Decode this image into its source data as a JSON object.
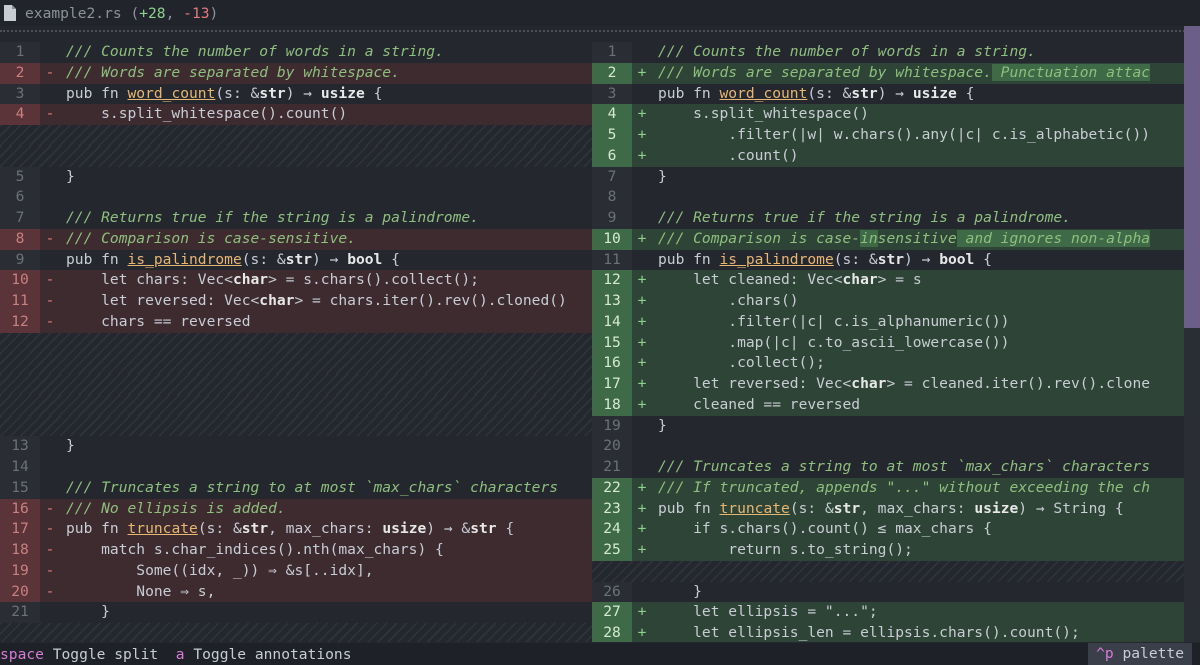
{
  "header": {
    "filename": "example2.rs",
    "open": " (",
    "added": "+28",
    "sep": ", ",
    "removed": "-13",
    "close": ")"
  },
  "footer": {
    "key1": "space",
    "label1": " Toggle split",
    "key2": "a",
    "label2": " Toggle annotations",
    "palette_key": "^p",
    "palette_label": " palette"
  },
  "colors": {
    "added": "#8fd08f",
    "removed": "#e57a7a",
    "accent": "#6b5f8a"
  },
  "left": [
    {
      "t": "norm",
      "n": "1",
      "g": "",
      "c": [
        [
          "com",
          "/// Counts the number of words in a string."
        ]
      ]
    },
    {
      "t": "del",
      "n": "2",
      "g": "-",
      "c": [
        [
          "com",
          "/// Words are separated by whitespace."
        ]
      ]
    },
    {
      "t": "norm",
      "n": "3",
      "g": "",
      "c": [
        [
          "kw",
          "pub fn "
        ],
        [
          "fn",
          "word_count"
        ],
        [
          "kw",
          "(s: &"
        ],
        [
          "ty",
          "str"
        ],
        [
          "kw",
          ") → "
        ],
        [
          "ty",
          "usize"
        ],
        [
          "kw",
          " {"
        ]
      ]
    },
    {
      "t": "del",
      "n": "4",
      "g": "-",
      "c": [
        [
          "kw",
          "    s.split_whitespace().count()"
        ]
      ]
    },
    {
      "t": "filler"
    },
    {
      "t": "filler"
    },
    {
      "t": "norm",
      "n": "5",
      "g": "",
      "c": [
        [
          "kw",
          "}"
        ]
      ]
    },
    {
      "t": "norm",
      "n": "6",
      "g": "",
      "c": []
    },
    {
      "t": "norm",
      "n": "7",
      "g": "",
      "c": [
        [
          "com",
          "/// Returns true if the string is a palindrome."
        ]
      ]
    },
    {
      "t": "del",
      "n": "8",
      "g": "-",
      "c": [
        [
          "com",
          "/// Comparison is case-sensitive."
        ]
      ]
    },
    {
      "t": "norm",
      "n": "9",
      "g": "",
      "c": [
        [
          "kw",
          "pub fn "
        ],
        [
          "fn",
          "is_palindrome"
        ],
        [
          "kw",
          "(s: &"
        ],
        [
          "ty",
          "str"
        ],
        [
          "kw",
          ") → "
        ],
        [
          "ty",
          "bool"
        ],
        [
          "kw",
          " {"
        ]
      ]
    },
    {
      "t": "del",
      "n": "10",
      "g": "-",
      "c": [
        [
          "kw",
          "    let chars: Vec<"
        ],
        [
          "ty",
          "char"
        ],
        [
          "kw",
          "> = s.chars().collect();"
        ]
      ]
    },
    {
      "t": "del",
      "n": "11",
      "g": "-",
      "c": [
        [
          "kw",
          "    let reversed: Vec<"
        ],
        [
          "ty",
          "char"
        ],
        [
          "kw",
          "> = chars.iter().rev().cloned()"
        ]
      ]
    },
    {
      "t": "del",
      "n": "12",
      "g": "-",
      "c": [
        [
          "kw",
          "    chars == reversed"
        ]
      ]
    },
    {
      "t": "filler"
    },
    {
      "t": "filler"
    },
    {
      "t": "filler"
    },
    {
      "t": "filler"
    },
    {
      "t": "filler"
    },
    {
      "t": "norm",
      "n": "13",
      "g": "",
      "c": [
        [
          "kw",
          "}"
        ]
      ]
    },
    {
      "t": "norm",
      "n": "14",
      "g": "",
      "c": []
    },
    {
      "t": "norm",
      "n": "15",
      "g": "",
      "c": [
        [
          "com",
          "/// Truncates a string to at most `max_chars` characters"
        ]
      ]
    },
    {
      "t": "del",
      "n": "16",
      "g": "-",
      "c": [
        [
          "com",
          "/// No ellipsis is added."
        ]
      ]
    },
    {
      "t": "del",
      "n": "17",
      "g": "-",
      "c": [
        [
          "kw",
          "pub fn "
        ],
        [
          "fn",
          "truncate"
        ],
        [
          "kw",
          "(s: &"
        ],
        [
          "ty",
          "str"
        ],
        [
          "kw",
          ", max_chars: "
        ],
        [
          "ty",
          "usize"
        ],
        [
          "kw",
          ") → &"
        ],
        [
          "ty",
          "str"
        ],
        [
          "kw",
          " {"
        ]
      ]
    },
    {
      "t": "del",
      "n": "18",
      "g": "-",
      "c": [
        [
          "kw",
          "    match s.char_indices().nth(max_chars) {"
        ]
      ]
    },
    {
      "t": "del",
      "n": "19",
      "g": "-",
      "c": [
        [
          "kw",
          "        Some((idx, _)) ⇒ &s[..idx],"
        ]
      ]
    },
    {
      "t": "del",
      "n": "20",
      "g": "-",
      "c": [
        [
          "kw",
          "        None ⇒ s,"
        ]
      ]
    },
    {
      "t": "norm",
      "n": "21",
      "g": "",
      "c": [
        [
          "kw",
          "    }"
        ]
      ]
    },
    {
      "t": "filler"
    },
    {
      "t": "filler"
    }
  ],
  "right": [
    {
      "t": "norm",
      "n": "1",
      "g": "",
      "c": [
        [
          "com",
          "/// Counts the number of words in a string."
        ]
      ]
    },
    {
      "t": "add",
      "n": "2",
      "g": "+",
      "c": [
        [
          "com",
          "/// Words are separated by whitespace."
        ],
        [
          "comhl",
          " Punctuation attac"
        ]
      ]
    },
    {
      "t": "norm",
      "n": "3",
      "g": "",
      "c": [
        [
          "kw",
          "pub fn "
        ],
        [
          "fn",
          "word_count"
        ],
        [
          "kw",
          "(s: &"
        ],
        [
          "ty",
          "str"
        ],
        [
          "kw",
          ") → "
        ],
        [
          "ty",
          "usize"
        ],
        [
          "kw",
          " {"
        ]
      ]
    },
    {
      "t": "add",
      "n": "4",
      "g": "+",
      "c": [
        [
          "kw",
          "    s.split_whitespace()"
        ]
      ]
    },
    {
      "t": "add",
      "n": "5",
      "g": "+",
      "c": [
        [
          "kw",
          "        .filter(|w| w.chars().any(|c| c.is_alphabetic())"
        ]
      ]
    },
    {
      "t": "add",
      "n": "6",
      "g": "+",
      "c": [
        [
          "kw",
          "        .count()"
        ]
      ]
    },
    {
      "t": "norm",
      "n": "7",
      "g": "",
      "c": [
        [
          "kw",
          "}"
        ]
      ]
    },
    {
      "t": "norm",
      "n": "8",
      "g": "",
      "c": []
    },
    {
      "t": "norm",
      "n": "9",
      "g": "",
      "c": [
        [
          "com",
          "/// Returns true if the string is a palindrome."
        ]
      ]
    },
    {
      "t": "add",
      "n": "10",
      "g": "+",
      "c": [
        [
          "com",
          "/// Comparison is case-"
        ],
        [
          "comhl",
          "in"
        ],
        [
          "com",
          "sensitive"
        ],
        [
          "comhl",
          " and ignores non-alpha"
        ]
      ]
    },
    {
      "t": "norm",
      "n": "11",
      "g": "",
      "c": [
        [
          "kw",
          "pub fn "
        ],
        [
          "fn",
          "is_palindrome"
        ],
        [
          "kw",
          "(s: &"
        ],
        [
          "ty",
          "str"
        ],
        [
          "kw",
          ") → "
        ],
        [
          "ty",
          "bool"
        ],
        [
          "kw",
          " {"
        ]
      ]
    },
    {
      "t": "add",
      "n": "12",
      "g": "+",
      "c": [
        [
          "kw",
          "    let cleaned: Vec<"
        ],
        [
          "ty",
          "char"
        ],
        [
          "kw",
          "> = s"
        ]
      ]
    },
    {
      "t": "add",
      "n": "13",
      "g": "+",
      "c": [
        [
          "kw",
          "        .chars()"
        ]
      ]
    },
    {
      "t": "add",
      "n": "14",
      "g": "+",
      "c": [
        [
          "kw",
          "        .filter(|c| c.is_alphanumeric())"
        ]
      ]
    },
    {
      "t": "add",
      "n": "15",
      "g": "+",
      "c": [
        [
          "kw",
          "        .map(|c| c.to_ascii_lowercase())"
        ]
      ]
    },
    {
      "t": "add",
      "n": "16",
      "g": "+",
      "c": [
        [
          "kw",
          "        .collect();"
        ]
      ]
    },
    {
      "t": "add",
      "n": "17",
      "g": "+",
      "c": [
        [
          "kw",
          "    let reversed: Vec<"
        ],
        [
          "ty",
          "char"
        ],
        [
          "kw",
          "> = cleaned.iter().rev().clone"
        ]
      ]
    },
    {
      "t": "add",
      "n": "18",
      "g": "+",
      "c": [
        [
          "kw",
          "    cleaned == reversed"
        ]
      ]
    },
    {
      "t": "norm",
      "n": "19",
      "g": "",
      "c": [
        [
          "kw",
          "}"
        ]
      ]
    },
    {
      "t": "norm",
      "n": "20",
      "g": "",
      "c": []
    },
    {
      "t": "norm",
      "n": "21",
      "g": "",
      "c": [
        [
          "com",
          "/// Truncates a string to at most `max_chars` characters"
        ]
      ]
    },
    {
      "t": "add",
      "n": "22",
      "g": "+",
      "c": [
        [
          "com",
          "/// If truncated, appends \"...\" without exceeding the ch"
        ]
      ]
    },
    {
      "t": "add",
      "n": "23",
      "g": "+",
      "c": [
        [
          "kw",
          "pub fn "
        ],
        [
          "fn",
          "truncate"
        ],
        [
          "kw",
          "(s: &"
        ],
        [
          "ty",
          "str"
        ],
        [
          "kw",
          ", max_chars: "
        ],
        [
          "ty",
          "usize"
        ],
        [
          "kw",
          ") → String {"
        ]
      ]
    },
    {
      "t": "add",
      "n": "24",
      "g": "+",
      "c": [
        [
          "kw",
          "    if s.chars().count() ≤ max_chars {"
        ]
      ]
    },
    {
      "t": "add",
      "n": "25",
      "g": "+",
      "c": [
        [
          "kw",
          "        return s.to_string();"
        ]
      ]
    },
    {
      "t": "filler"
    },
    {
      "t": "norm",
      "n": "26",
      "g": "",
      "c": [
        [
          "kw",
          "    }"
        ]
      ]
    },
    {
      "t": "add",
      "n": "27",
      "g": "+",
      "c": [
        [
          "kw",
          "    let ellipsis = \"...\";"
        ]
      ]
    },
    {
      "t": "add",
      "n": "28",
      "g": "+",
      "c": [
        [
          "kw",
          "    let ellipsis_len = ellipsis.chars().count();"
        ]
      ]
    }
  ]
}
